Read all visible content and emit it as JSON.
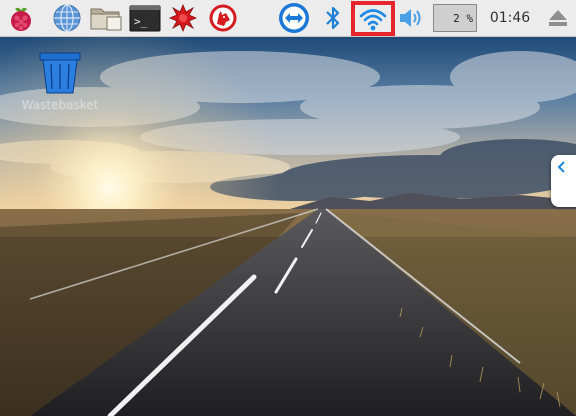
{
  "taskbar": {
    "cpu_meter": "2 %",
    "clock": "01:46",
    "icons": [
      "raspberry-menu-icon",
      "web-browser-icon",
      "file-manager-icon",
      "terminal-icon",
      "wolfram-icon",
      "mathematica-icon",
      "teamviewer-icon",
      "bluetooth-icon",
      "wifi-icon",
      "volume-icon",
      "eject-icon"
    ],
    "colors": {
      "highlight": "#e8242c",
      "accent_blue": "#1e88e5"
    }
  },
  "desktop": {
    "wastebasket_label": "Wastebasket"
  }
}
